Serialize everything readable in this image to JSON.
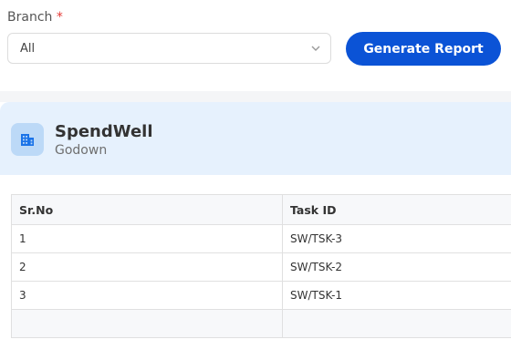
{
  "filter": {
    "branch_label": "Branch",
    "required_mark": "*",
    "branch_value": "All",
    "generate_button": "Generate Report"
  },
  "org": {
    "name": "SpendWell",
    "subtitle": "Godown",
    "icon": "building-icon"
  },
  "table": {
    "headers": [
      "Sr.No",
      "Task ID"
    ],
    "rows": [
      [
        "1",
        "SW/TSK-3"
      ],
      [
        "2",
        "SW/TSK-2"
      ],
      [
        "3",
        "SW/TSK-1"
      ]
    ]
  },
  "colors": {
    "accent": "#0b53d6",
    "header_bg": "#e6f1fd",
    "icon_bg": "#bcd9f7",
    "required": "#e53935"
  }
}
